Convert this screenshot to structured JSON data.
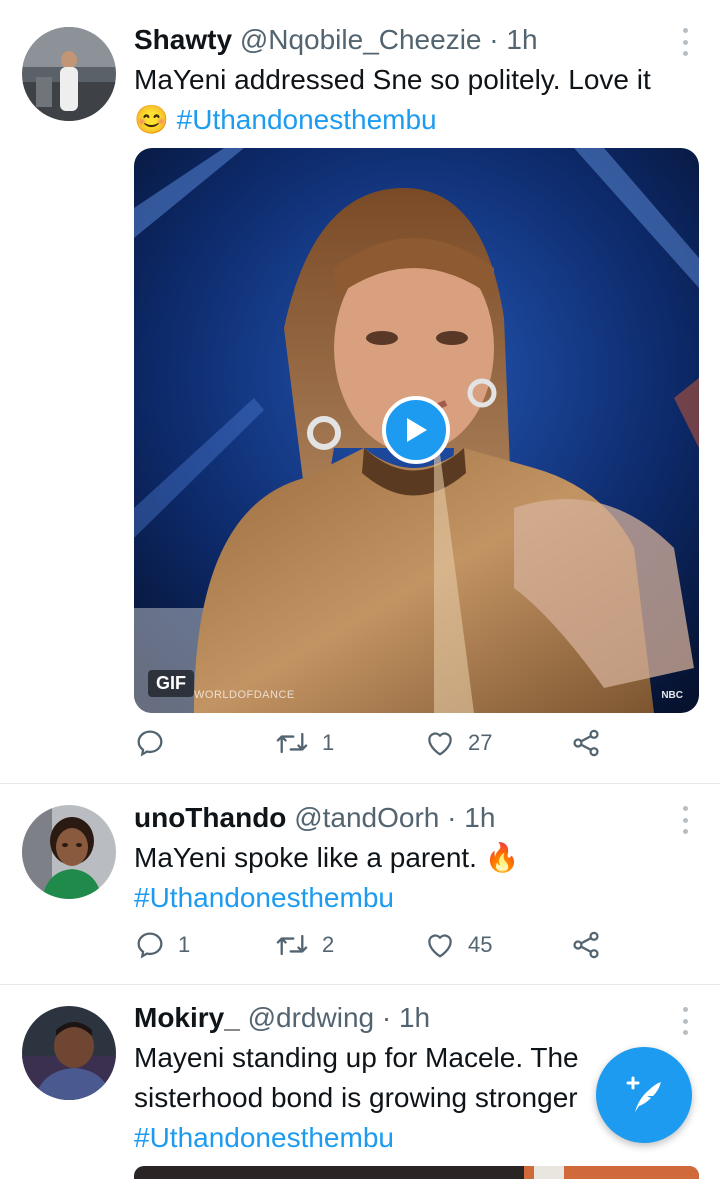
{
  "tweets": [
    {
      "name": "Shawty",
      "handle": "@Nqobile_Cheezie",
      "sep": "·",
      "time": "1h",
      "text": "MaYeni addressed Sne so politely. Love it",
      "emoji": "😊",
      "hashtag": "#Uthandonesthembu",
      "media": {
        "badge": "GIF",
        "watermark": "WORLDOFDANCE",
        "network": "NBC"
      },
      "replies": "",
      "retweets": "1",
      "likes": "27"
    },
    {
      "name": "unoThando",
      "handle": "@tandOorh",
      "sep": "·",
      "time": "1h",
      "text": "MaYeni spoke like a parent.",
      "emoji": "🔥",
      "hashtag": "#Uthandonesthembu",
      "replies": "1",
      "retweets": "2",
      "likes": "45"
    },
    {
      "name": "Mokiry_",
      "handle": "@drdwing",
      "sep": "·",
      "time": "1h",
      "text_line1": "Mayeni standing up for Macele. The",
      "text_line2": "sisterhood bond is growing stronger",
      "hashtag": "#Uthandonesthembu"
    }
  ],
  "colors": {
    "accent": "#1d9bf0",
    "muted": "#536471",
    "divider": "#e6e9eb"
  },
  "icons": [
    "reply-icon",
    "retweet-icon",
    "like-icon",
    "share-icon",
    "more-icon",
    "play-icon",
    "compose-tweet-icon"
  ]
}
